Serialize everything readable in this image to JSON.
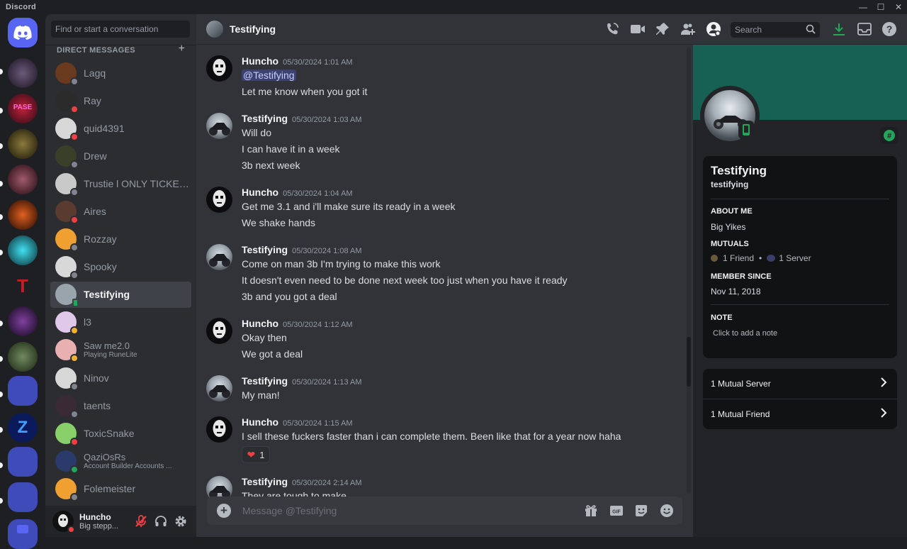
{
  "app": {
    "name": "Discord"
  },
  "window_controls": {
    "minimize": "—",
    "maximize": "☐",
    "close": "✕"
  },
  "dm_sidebar": {
    "search_placeholder": "Find or start a conversation",
    "header": "DIRECT MESSAGES",
    "add": "+",
    "items": [
      {
        "name": "Lagq",
        "status": "offline",
        "color": "#6a3a1e"
      },
      {
        "name": "Ray",
        "status": "dnd",
        "color": "#2b2b2b"
      },
      {
        "name": "quid4391",
        "status": "dnd",
        "color": "#d8d8d8"
      },
      {
        "name": "Drew",
        "status": "offline",
        "color": "#3a3f2a"
      },
      {
        "name": "Trustie l ONLY TICKETS",
        "status": "offline",
        "color": "#c9c9c9"
      },
      {
        "name": "Aires",
        "status": "dnd",
        "color": "#5a3b30"
      },
      {
        "name": "Rozzay",
        "status": "offline",
        "color": "#f0a030"
      },
      {
        "name": "Spooky",
        "status": "offline",
        "color": "#d8d8d8"
      },
      {
        "name": "Testifying",
        "status": "mobile",
        "color": "#9aa4ad",
        "selected": true
      },
      {
        "name": "l3",
        "status": "idle",
        "color": "#e0c8e8"
      },
      {
        "name": "Saw me2.0",
        "sub": "Playing RuneLite",
        "status": "idle",
        "color": "#e8b0b0"
      },
      {
        "name": "Ninov",
        "status": "offline",
        "color": "#d8d8d8"
      },
      {
        "name": "taents",
        "status": "offline",
        "color": "#3a2a35"
      },
      {
        "name": "ToxicSnake",
        "status": "dnd",
        "color": "#8ad06a"
      },
      {
        "name": "QaziOsRs",
        "sub": "Account Builder Accounts ...",
        "status": "online",
        "color": "#2a3a6a"
      },
      {
        "name": "Folemeister",
        "status": "offline",
        "color": "#f0a030"
      }
    ]
  },
  "user_panel": {
    "name": "Huncho",
    "status": "Big stepp..."
  },
  "chat": {
    "title": "Testifying",
    "search_placeholder": "Search",
    "composer_placeholder": "Message @Testifying",
    "messages": [
      {
        "author": "Huncho",
        "time": "05/30/2024 1:01 AM",
        "lines": [
          "@Testifying",
          "Let me know when you got it"
        ]
      },
      {
        "author": "Testifying",
        "time": "05/30/2024 1:03 AM",
        "lines": [
          "Will do",
          "I can have it in a week",
          "3b next week"
        ]
      },
      {
        "author": "Huncho",
        "time": "05/30/2024 1:04 AM",
        "lines": [
          "Get me 3.1 and i'll make sure its ready in a week",
          "We shake hands"
        ]
      },
      {
        "author": "Testifying",
        "time": "05/30/2024 1:08 AM",
        "lines": [
          "Come on man 3b I'm trying to make this work",
          "It doesn't even  need to be done next week too just when you have it ready",
          "3b and you got a deal"
        ]
      },
      {
        "author": "Huncho",
        "time": "05/30/2024 1:12 AM",
        "lines": [
          "Okay then",
          "We got a deal"
        ]
      },
      {
        "author": "Testifying",
        "time": "05/30/2024 1:13 AM",
        "lines": [
          "My man!"
        ]
      },
      {
        "author": "Huncho",
        "time": "05/30/2024 1:15 AM",
        "lines": [
          "I sell these fuckers faster than i can complete them. Been like that for a year now haha"
        ],
        "reaction": {
          "emoji": "❤",
          "count": "1"
        }
      },
      {
        "author": "Testifying",
        "time": "05/30/2024 2:14 AM",
        "lines": [
          "They are tough to make"
        ]
      }
    ]
  },
  "profile": {
    "display_name": "Testifying",
    "username": "testifying",
    "about_label": "ABOUT ME",
    "about": "Big Yikes",
    "mutuals_label": "MUTUALS",
    "mutual_friend": "1 Friend",
    "mutual_server": "1 Server",
    "member_since_label": "MEMBER SINCE",
    "member_since": "Nov 11, 2018",
    "note_label": "NOTE",
    "note_placeholder": "Click to add a note",
    "row_servers": "1 Mutual Server",
    "row_friends": "1 Mutual Friend",
    "banner_color": "#176154"
  }
}
